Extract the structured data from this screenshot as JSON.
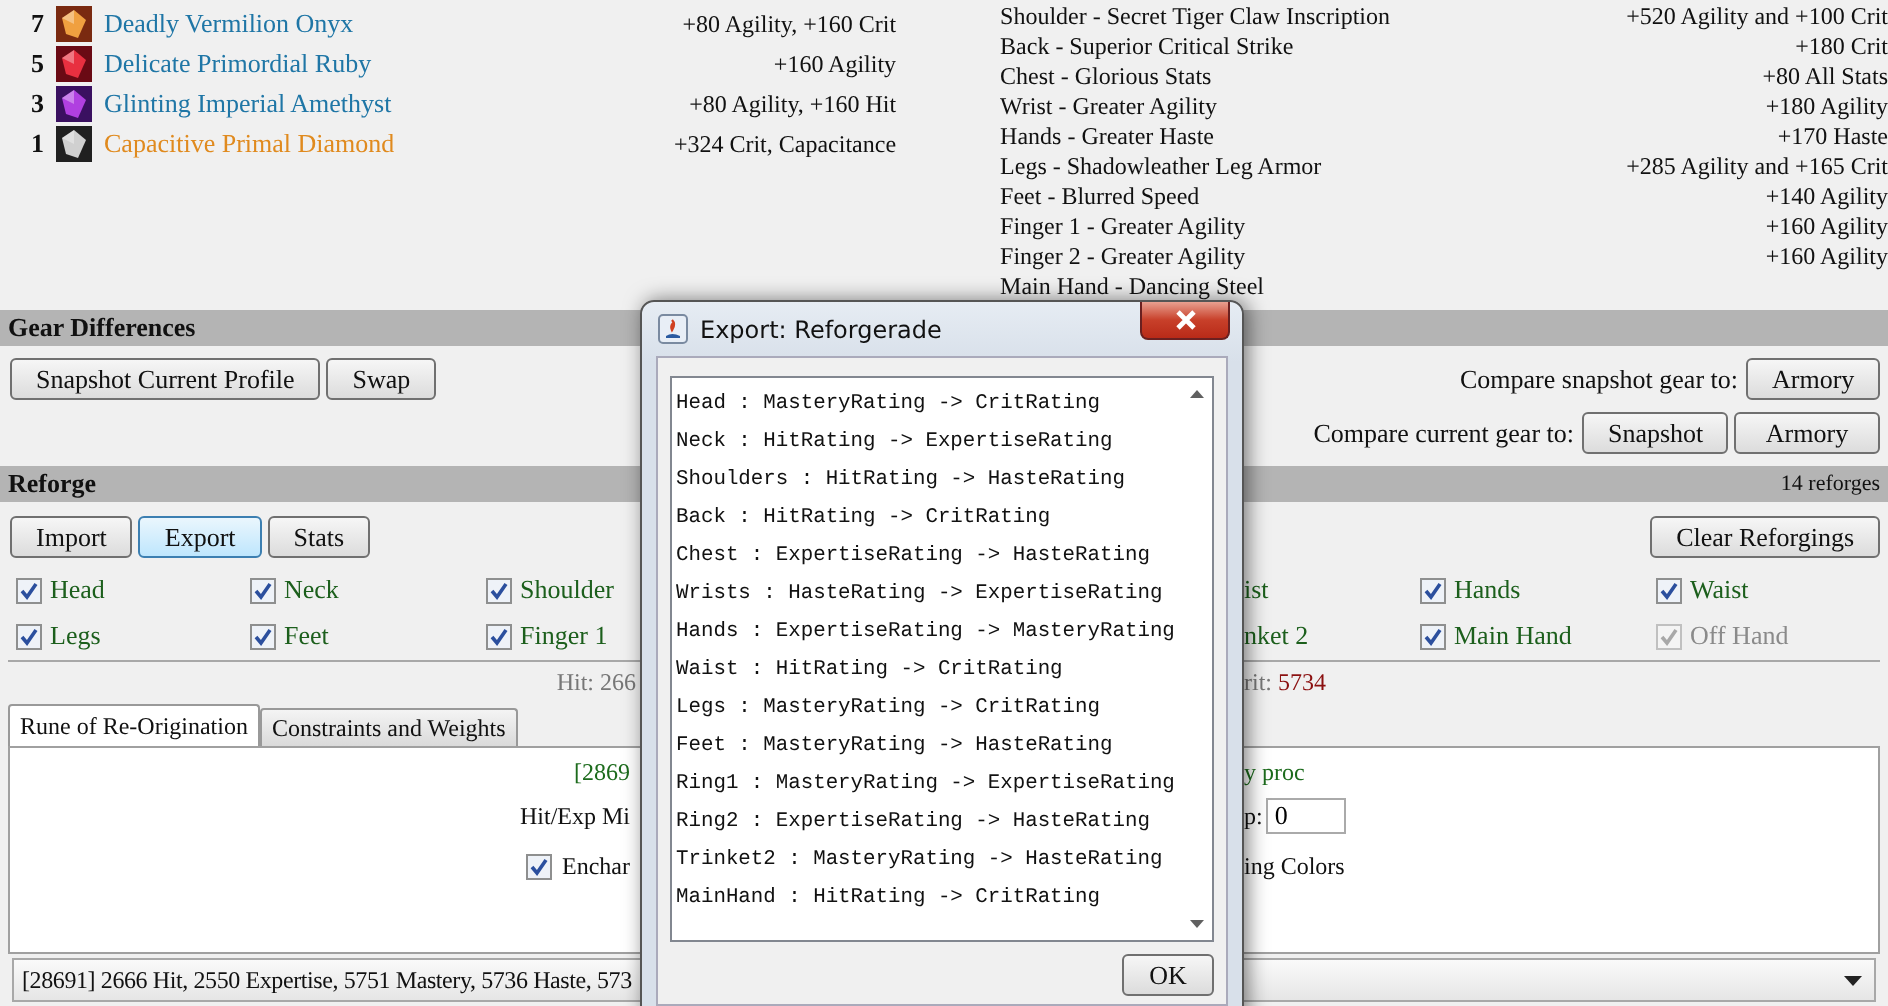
{
  "gems": [
    {
      "count": "7",
      "name": "Deadly Vermilion Onyx",
      "stats": "+80 Agility, +160 Crit",
      "color": "#1f76a6"
    },
    {
      "count": "5",
      "name": "Delicate Primordial Ruby",
      "stats": "+160 Agility",
      "color": "#1f76a6"
    },
    {
      "count": "3",
      "name": "Glinting Imperial Amethyst",
      "stats": "+80 Agility, +160 Hit",
      "color": "#1f76a6"
    },
    {
      "count": "1",
      "name": "Capacitive Primal Diamond",
      "stats": "+324 Crit, Capacitance",
      "color": "#e08a1e"
    }
  ],
  "enchants": [
    {
      "name": "Shoulder - Secret Tiger Claw Inscription",
      "bonus": "+520 Agility and +100 Crit"
    },
    {
      "name": "Back - Superior Critical Strike",
      "bonus": "+180 Crit"
    },
    {
      "name": "Chest - Glorious Stats",
      "bonus": "+80 All Stats"
    },
    {
      "name": "Wrist - Greater Agility",
      "bonus": "+180 Agility"
    },
    {
      "name": "Hands - Greater Haste",
      "bonus": "+170 Haste"
    },
    {
      "name": "Legs - Shadowleather Leg Armor",
      "bonus": "+285 Agility and +165 Crit"
    },
    {
      "name": "Feet - Blurred Speed",
      "bonus": "+140 Agility"
    },
    {
      "name": "Finger 1 - Greater Agility",
      "bonus": "+160 Agility"
    },
    {
      "name": "Finger 2 - Greater Agility",
      "bonus": "+160 Agility"
    },
    {
      "name": "Main Hand - Dancing Steel"
    }
  ],
  "gear_differences": {
    "title": "Gear Differences",
    "buttons": [
      "Snapshot Current Profile",
      "Swap"
    ],
    "compare_snapshot": {
      "label": "Compare snapshot gear to:",
      "buttons": [
        "Armory"
      ]
    },
    "compare_current": {
      "label": "Compare current gear to:",
      "buttons": [
        "Snapshot",
        "Armory"
      ]
    }
  },
  "reforge": {
    "title": "Reforge",
    "count": "14 reforges",
    "buttons": [
      {
        "label": "Import",
        "selected": false
      },
      {
        "label": "Export",
        "selected": true
      },
      {
        "label": "Stats",
        "selected": false
      }
    ],
    "clear_button": "Clear Reforgings",
    "slot_rows": [
      {
        "left": [
          {
            "label": "Head",
            "checked": true,
            "disabled": false
          },
          {
            "label": "Neck",
            "checked": true,
            "disabled": false
          },
          {
            "label": "Shoulder",
            "checked": true,
            "disabled": false
          }
        ],
        "partial": "ist",
        "right": [
          {
            "label": "Hands",
            "checked": true,
            "disabled": false
          },
          {
            "label": "Waist",
            "checked": true,
            "disabled": false
          }
        ]
      },
      {
        "left": [
          {
            "label": "Legs",
            "checked": true,
            "disabled": false
          },
          {
            "label": "Feet",
            "checked": true,
            "disabled": false
          },
          {
            "label": "Finger 1",
            "checked": true,
            "disabled": false
          }
        ],
        "partial": "nket 2",
        "right": [
          {
            "label": "Main Hand",
            "checked": true,
            "disabled": false
          },
          {
            "label": "Off Hand",
            "checked": true,
            "disabled": true
          }
        ]
      }
    ],
    "stats_left": "Hit: 266",
    "stats_right_label": "rit: ",
    "stats_right_value": "5734"
  },
  "tabs": [
    {
      "label": "Rune of Re-Origination",
      "selected": true
    },
    {
      "label": "Constraints and Weights",
      "selected": false
    }
  ],
  "rune_panel": {
    "proc_left": "[2869",
    "proc_right": "y proc",
    "min_label_left": "Hit/Exp Mi",
    "min_label_right": "p:",
    "min_value": "0",
    "enchant_checked": true,
    "enchant_left": "Enchar",
    "enchant_right": "ing Colors"
  },
  "result_dropdown": {
    "value": "[28691] 2666 Hit, 2550 Expertise, 5751 Mastery, 5736 Haste, 573"
  },
  "dialog": {
    "title": "Export: Reforgerade",
    "lines": [
      "Head : MasteryRating -> CritRating",
      "Neck : HitRating -> ExpertiseRating",
      "Shoulders : HitRating -> HasteRating",
      "Back : HitRating -> CritRating",
      "Chest : ExpertiseRating -> HasteRating",
      "Wrists : HasteRating -> ExpertiseRating",
      "Hands : ExpertiseRating -> MasteryRating",
      "Waist : HitRating -> CritRating",
      "Legs : MasteryRating -> CritRating",
      "Feet : MasteryRating -> HasteRating",
      "Ring1 : MasteryRating -> ExpertiseRating",
      "Ring2 : ExpertiseRating -> HasteRating",
      "Trinket2 : MasteryRating -> HasteRating",
      "MainHand : HitRating -> CritRating"
    ],
    "ok": "OK"
  }
}
